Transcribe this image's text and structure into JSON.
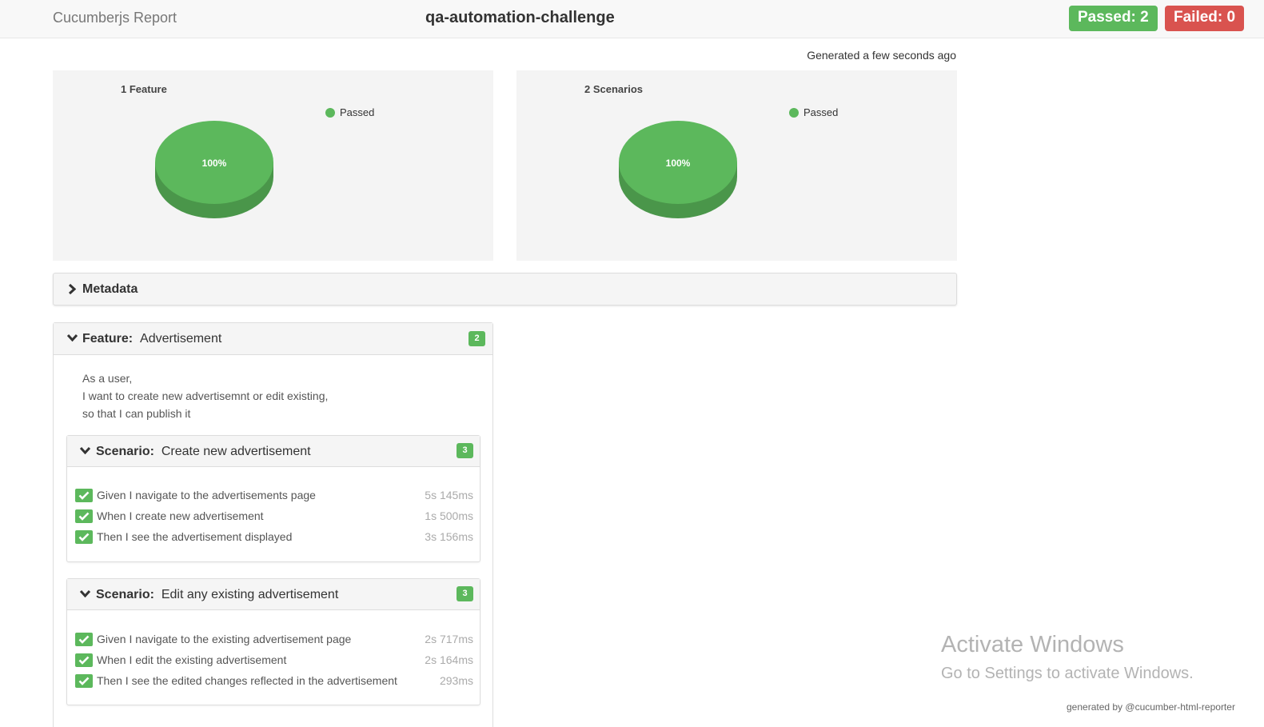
{
  "header": {
    "brand": "Cucumberjs Report",
    "project": "qa-automation-challenge",
    "passed_label": "Passed: 2",
    "failed_label": "Failed: 0"
  },
  "generated": "Generated a few seconds ago",
  "charts": [
    {
      "title": "1 Feature",
      "legend": "Passed",
      "slice_label": "100%",
      "passed_fraction": 1.0
    },
    {
      "title": "2 Scenarios",
      "legend": "Passed",
      "slice_label": "100%",
      "passed_fraction": 1.0
    }
  ],
  "metadata": {
    "label": "Metadata"
  },
  "feature": {
    "keyword": "Feature:",
    "name": "Advertisement",
    "count": "2",
    "description": [
      "As a user,",
      "I want to create new advertisemnt or edit existing,",
      "so that I can publish it"
    ],
    "scenarios": [
      {
        "keyword": "Scenario:",
        "name": "Create new advertisement",
        "count": "3",
        "steps": [
          {
            "text": "Given I navigate to the advertisements page",
            "duration": "5s 145ms"
          },
          {
            "text": "When I create new advertisement",
            "duration": "1s 500ms"
          },
          {
            "text": "Then I see the advertisement displayed",
            "duration": "3s 156ms"
          }
        ]
      },
      {
        "keyword": "Scenario:",
        "name": "Edit any existing advertisement",
        "count": "3",
        "steps": [
          {
            "text": "Given I navigate to the existing advertisement page",
            "duration": "2s 717ms"
          },
          {
            "text": "When I edit the existing advertisement",
            "duration": "2s 164ms"
          },
          {
            "text": "Then I see the edited changes reflected in the advertisement",
            "duration": "293ms"
          }
        ]
      }
    ]
  },
  "colors": {
    "passed": "#5cb85c",
    "failed": "#d9534f"
  },
  "watermark": {
    "line1": "Activate Windows",
    "line2": "Go to Settings to activate Windows."
  },
  "footer": "generated by @cucumber-html-reporter"
}
